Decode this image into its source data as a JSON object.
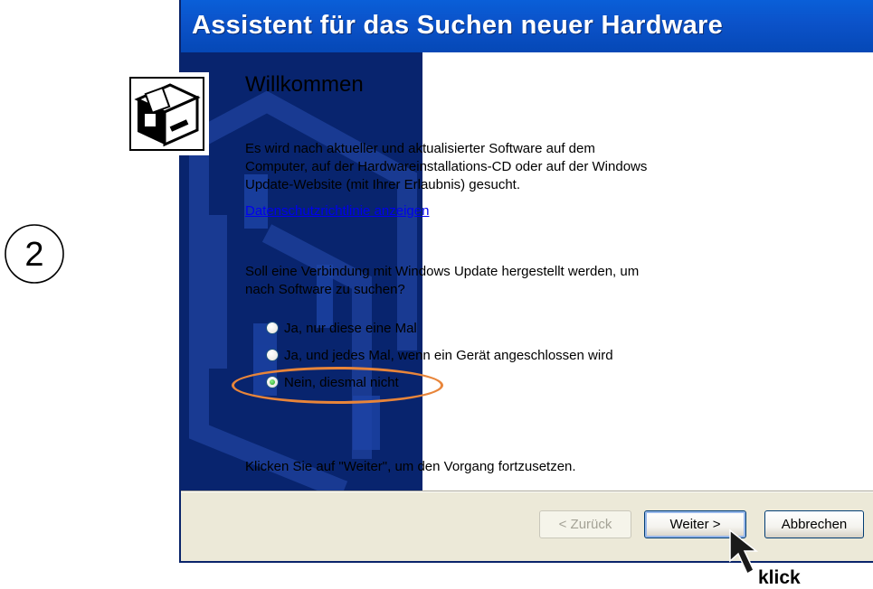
{
  "step_marker": "2",
  "window": {
    "title": "Assistent für das Suchen neuer Hardware"
  },
  "content": {
    "heading": "Willkommen",
    "intro": "Es wird nach aktueller und aktualisierter Software auf dem Computer, auf der Hardwareinstallations-CD oder auf der Windows Update-Website (mit Ihrer Erlaubnis) gesucht.",
    "privacy_link": "Datenschutzrichtlinie anzeigen",
    "question": "Soll eine Verbindung mit Windows Update hergestellt werden, um nach Software zu suchen?",
    "options": [
      {
        "label": "Ja, nur diese eine Mal",
        "checked": false
      },
      {
        "label": "Ja, und jedes Mal, wenn ein Gerät angeschlossen wird",
        "checked": false
      },
      {
        "label": "Nein, diesmal nicht",
        "checked": true
      }
    ],
    "continue_hint": "Klicken Sie auf \"Weiter\", um den Vorgang fortzusetzen."
  },
  "buttons": {
    "back": "< Zurück",
    "next": "Weiter >",
    "cancel": "Abbrechen"
  },
  "annotation": {
    "click_label": "klick",
    "highlight_color": "#e8853a"
  },
  "colors": {
    "titlebar": "#0b52c9",
    "sidebar": "#08246e",
    "dialog_bg": "#ece9d8",
    "link": "#0000ee"
  }
}
